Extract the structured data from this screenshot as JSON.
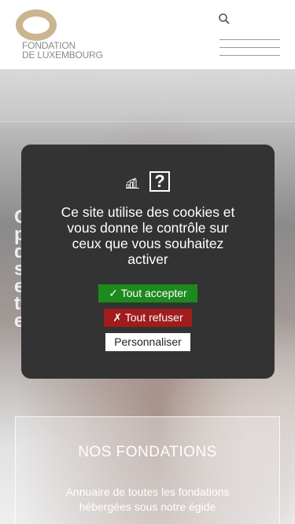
{
  "header": {
    "logo_line1": "FONDATION",
    "logo_line2": "DE LUXEMBOURG",
    "brand_color": "#cbb58e"
  },
  "hero": {
    "partial_text": [
      "C",
      "p",
      "d",
      "s",
      "e",
      "t",
      "e"
    ]
  },
  "card": {
    "title": "NOS FONDATIONS",
    "desc_line1": "Annuaire de toutes les fondations",
    "desc_line2": "hébergées sous notre égide"
  },
  "cookie_modal": {
    "icon_chart": "chart-icon",
    "icon_help": "question-icon",
    "help_glyph": "?",
    "message_lines": [
      "Ce site utilise des cookies et",
      "vous donne le contrôle sur",
      "ceux que vous souhaitez",
      "activer"
    ],
    "accept_label": "✓ Tout accepter",
    "refuse_label": "✗ Tout refuser",
    "customize_label": "Personnaliser",
    "accept_color": "#1c8a1c",
    "refuse_color": "#a31c1c"
  }
}
